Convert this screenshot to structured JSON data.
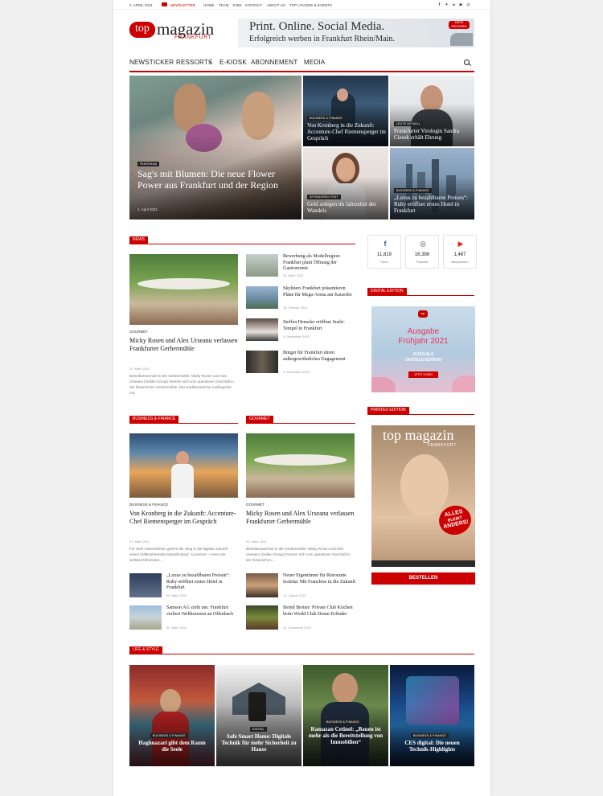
{
  "topbar": {
    "date": "2. APRIL 2021",
    "newsletter": "NEWSLETTER",
    "links": [
      "HOME",
      "TEAM",
      "JOBS",
      "KONTAKT",
      "ABOUT US",
      "TOP LOUNGE & EVENTS"
    ],
    "social_icons": [
      "facebook-icon",
      "twitter-icon",
      "linkedin-icon",
      "youtube-icon",
      "instagram-icon"
    ]
  },
  "logo": {
    "top": "top",
    "magazin": "magazin",
    "frankfurt": "FRANKFURT"
  },
  "banner": {
    "line1": "Print. Online. Social Media.",
    "line2": "Erfolgreich werben in Frankfurt Rhein/Main.",
    "cta": "MEHR ERFAHREN"
  },
  "nav": {
    "items": [
      "NEWSTICKER",
      "RESSORTS",
      "E-KIOSK",
      "ABONNEMENT",
      "MEDIA"
    ],
    "ressorts_caret": "▾"
  },
  "hero": {
    "main": {
      "tag": "PANORAMA",
      "title": "Sag's mit Blumen: Die neue Flower Power aus Frankfurt und der Region",
      "date": "1. April 2021"
    },
    "t1": {
      "tag": "BUSINESS & FINANCE",
      "title": "Von Kronberg in die Zukunft: Accenture-Chef Riemensperger im Gespräch"
    },
    "t2": {
      "tag": "LEUTE AKTUELL",
      "title": "Frankfurter Virologin Sandra Ciesek erhält Ehrung"
    },
    "t3": {
      "tag": "SPONSORED POST",
      "title": "Geld anlegen im Jahrzehnt des Wandels"
    },
    "t4": {
      "tag": "BUSINESS & FINANCE",
      "title": "„Luxus zu bezahlbaren Preisen“: Ruby eröffnet erstes Hotel in Frankfurt"
    }
  },
  "news": {
    "label": "NEWS",
    "main": {
      "category": "GOURMET",
      "title": "Micky Rosen und Alex Urseanu verlassen Frankfurter Gerbermühle",
      "date": "29. März 2021",
      "excerpt": "Betreiberwechsel in der Gerbermühle: Micky Rosen und Alex Urseanu (Gekko Group) trennen sich vom operativen Geschäft in der historischen Gerbermühle. Das traditionsreiche Ausflugsziel mit..."
    },
    "items": [
      {
        "title": "Bewerbung als Modellregion: Frankfurt plant Öffnung der Gastronomie",
        "date": "26. März 2021"
      },
      {
        "title": "Skyliners Frankfurt präsentieren Pläne für Mega-Arena am Kaiserlei",
        "date": "15. Februar 2021"
      },
      {
        "title": "Steffen Henssler eröffnet Sushi-Tempel in Frankfurt",
        "date": "4. Dezember 2020"
      },
      {
        "title": "Bürger für Frankfurt ehren außergewöhnliches Engagement",
        "date": "3. Dezember 2020"
      }
    ]
  },
  "sidebar": {
    "social": [
      {
        "count": "11,819",
        "unit": "Fans",
        "icon": "facebook-icon"
      },
      {
        "count": "16,386",
        "unit": "Follower",
        "icon": "instagram-icon"
      },
      {
        "count": "1,467",
        "unit": "Abonnenten",
        "icon": "youtube-icon"
      }
    ],
    "digital": {
      "label": "DIGITAL EDITION",
      "logo": "top",
      "line1": "Ausgabe",
      "line2": "Frühjahr 2021",
      "line3": "AUCH ALS",
      "line4": "DIGITALE EDITION",
      "button": "JETZT LESEN"
    },
    "printed": {
      "label": "PRINTED EDITION",
      "cover_title": "top magazin",
      "cover_sub": "FRANKFURT",
      "badge1": "ALLES",
      "badge2": "BLEIBT",
      "badge3": "ANDERS!",
      "button": "BESTELLEN"
    }
  },
  "business": {
    "label": "BUSINESS & FINANCE",
    "main": {
      "category": "BUSINESS & FINANCE",
      "title": "Von Kronberg in die Zukunft: Accenture-Chef Riemensperger im Gespräch",
      "date": "31. März 2021",
      "excerpt": "Für viele Unternehmen gleicht der Weg in die digitale Zukunft einem kräftezehrenden Marathonlauf. Accenture – eines der weltweit führenden..."
    },
    "items": [
      {
        "title": "„Luxus zu bezahlbaren Preisen“: Ruby eröffnet erstes Hotel in Frankfurt",
        "date": "30. März 2021"
      },
      {
        "title": "Samson AG zieht um: Frankfurt verliert Weltkonzern an Offenbach",
        "date": "30. März 2021"
      }
    ]
  },
  "gourmet": {
    "label": "GOURMET",
    "main": {
      "category": "GOURMET",
      "title": "Micky Rosen und Alex Urseanu verlassen Frankfurter Gerbermühle",
      "date": "29. März 2021",
      "excerpt": "Betreiberwechsel in der Gerbermühle: Micky Rosen und Alex Urseanu (Gekko Group) trennen sich vom operativen Geschäft in der historischen..."
    },
    "items": [
      {
        "title": "Neuer Eigentümer für Ristorante Isoletta: Mit Franchise in die Zukunft",
        "date": "12. Januar 2021"
      },
      {
        "title": "Bernd Breiter: Private Club Kitchen beim World Club Dome-Erfinder",
        "date": "22. Dezember 2020"
      }
    ]
  },
  "lifestyle": {
    "label": "LIFE & STYLE",
    "tiles": [
      {
        "tag": "BUSINESS & FINANCE",
        "title": "Haghnazari gibt dem Raum die Seele"
      },
      {
        "tag": "DIGITAL",
        "title": "Safe Smart Home: Digitale Technik für mehr Sicherheit zu Hause"
      },
      {
        "tag": "BUSINESS & FINANCE",
        "title": "Ramazan Cetinel: „Bauen ist mehr als die Bereitstellung von Immobilien“"
      },
      {
        "tag": "BUSINESS & FINANCE",
        "title": "CES digital: Die neuen Technik-Highlights"
      }
    ]
  }
}
